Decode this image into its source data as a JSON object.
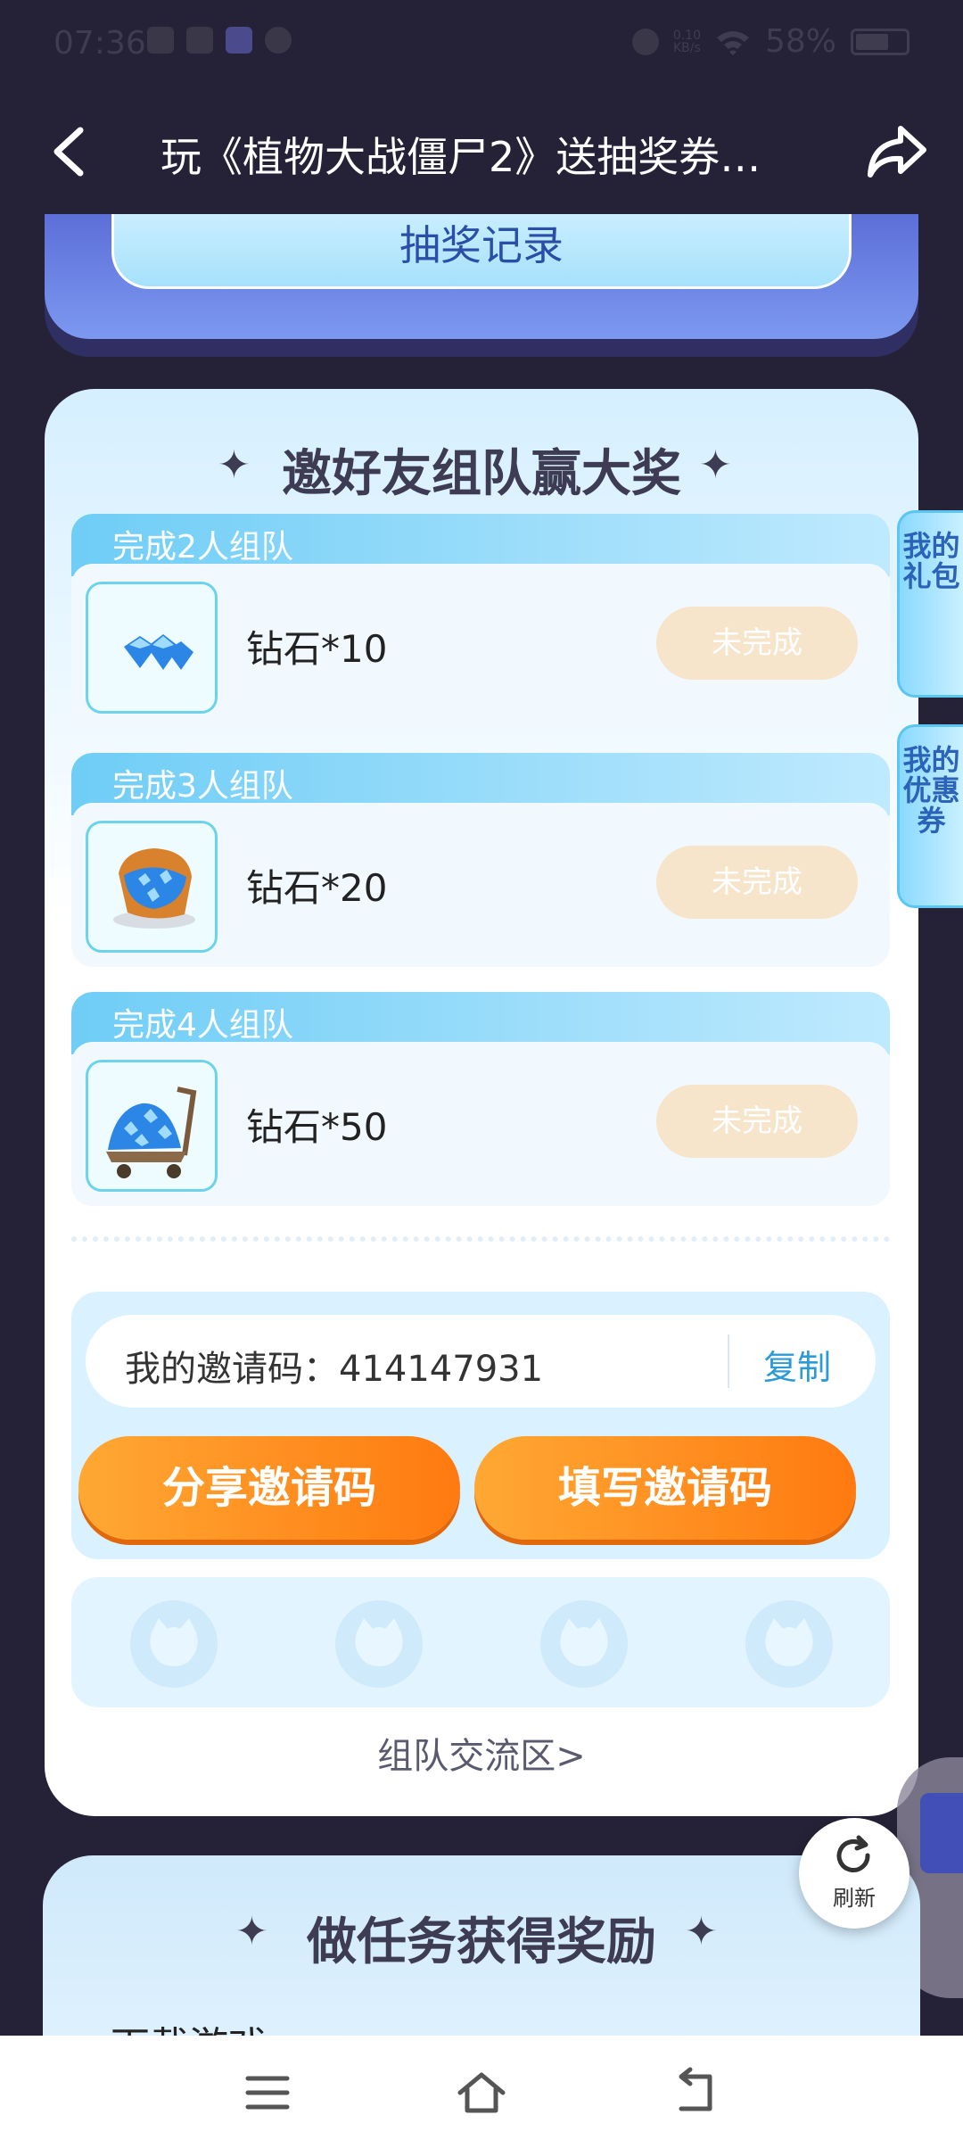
{
  "status": {
    "time": "07:36",
    "net_speed": "0.10\nKB/s",
    "battery": "58%"
  },
  "header": {
    "title": "玩《植物大战僵尸2》送抽奖券…",
    "lottery_record": "抽奖记录"
  },
  "team_section": {
    "title": "邀好友组队赢大奖",
    "tiers": [
      {
        "head": "完成2人组队",
        "reward": "钻石*10",
        "status": "未完成"
      },
      {
        "head": "完成3人组队",
        "reward": "钻石*20",
        "status": "未完成"
      },
      {
        "head": "完成4人组队",
        "reward": "钻石*50",
        "status": "未完成"
      }
    ],
    "invite_label": "我的邀请码：",
    "invite_code": "414147931",
    "copy": "复制",
    "share_btn": "分享邀请码",
    "fill_btn": "填写邀请码",
    "team_link": "组队交流区>"
  },
  "side_tabs": {
    "gift": "我的礼包",
    "coupon": "我的优惠券"
  },
  "refresh": "刷新",
  "task_section": {
    "title": "做任务获得奖励",
    "first_task": "下载游戏"
  },
  "colors": {
    "background": "#252137",
    "accent_orange": "#ff7a10",
    "status_pending": "#f6e4cb",
    "link_blue": "#2d9ad8"
  }
}
